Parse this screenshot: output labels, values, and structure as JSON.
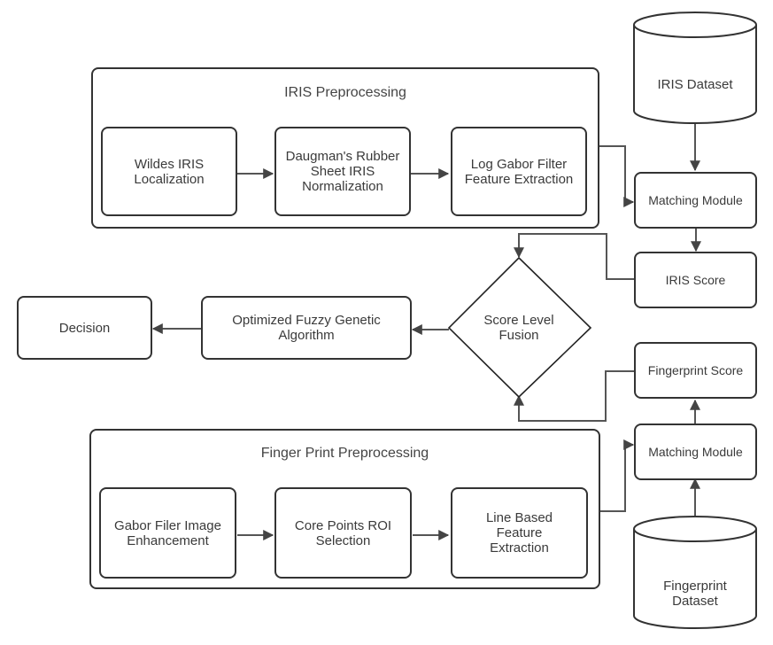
{
  "diagram": {
    "iris_group": {
      "title": "IRIS Preprocessing",
      "steps": [
        {
          "label": "Wildes IRIS Localization"
        },
        {
          "label": "Daugman's Rubber Sheet IRIS Normalization"
        },
        {
          "label": "Log Gabor Filter Feature Extraction"
        }
      ]
    },
    "fingerprint_group": {
      "title": "Finger Print Preprocessing",
      "steps": [
        {
          "label": "Gabor Filer Image Enhancement"
        },
        {
          "label": "Core Points ROI Selection"
        },
        {
          "label": "Line Based Feature Extraction"
        }
      ]
    },
    "iris_dataset": "IRIS Dataset",
    "fingerprint_dataset": "Fingerprint Dataset",
    "iris_matching": "Matching Module",
    "fingerprint_matching": "Matching Module",
    "iris_score": "IRIS Score",
    "fingerprint_score": "Fingerprint Score",
    "fusion": "Score Level Fusion",
    "optimizer": "Optimized Fuzzy Genetic Algorithm",
    "decision": "Decision",
    "colors": {
      "stroke": "#333333",
      "arrow": "#444444",
      "text": "#3a3a3a",
      "background": "#ffffff"
    }
  }
}
